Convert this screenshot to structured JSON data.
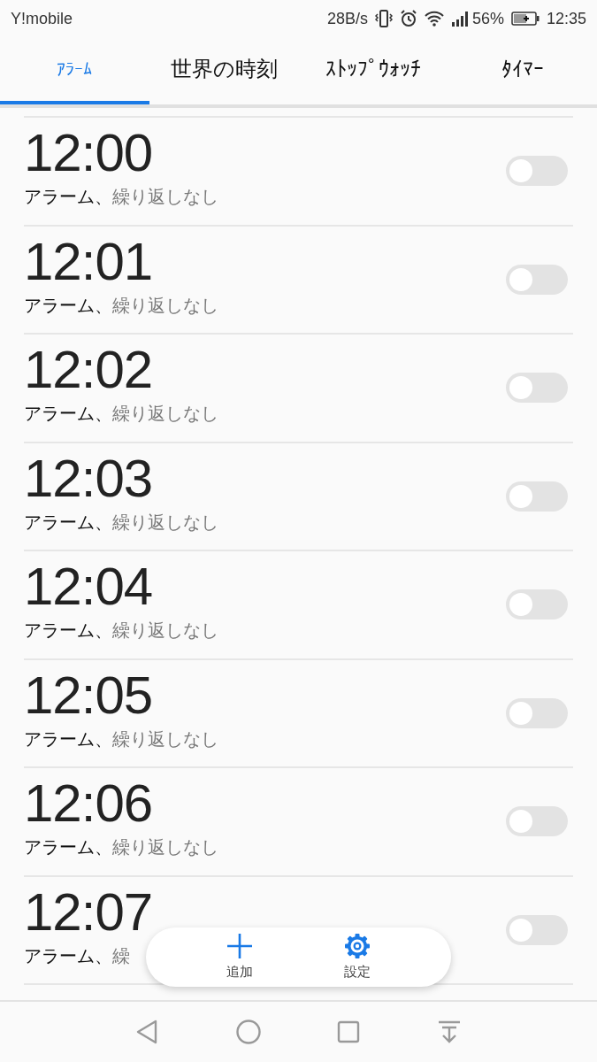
{
  "status_bar": {
    "carrier": "Y!mobile",
    "speed": "28B/s",
    "battery": "56%",
    "time": "12:35"
  },
  "tabs": [
    {
      "label": "ｱﾗｰﾑ",
      "selected": true
    },
    {
      "label": "世界の時刻",
      "selected": false
    },
    {
      "label": "ｽﾄｯﾌﾟｳｫｯﾁ",
      "selected": false
    },
    {
      "label": "ﾀｲﾏｰ",
      "selected": false
    }
  ],
  "alarms": [
    {
      "time": "12:00",
      "label": "アラーム、",
      "repeat": "繰り返しなし",
      "on": false
    },
    {
      "time": "12:01",
      "label": "アラーム、",
      "repeat": "繰り返しなし",
      "on": false
    },
    {
      "time": "12:02",
      "label": "アラーム、",
      "repeat": "繰り返しなし",
      "on": false
    },
    {
      "time": "12:03",
      "label": "アラーム、",
      "repeat": "繰り返しなし",
      "on": false
    },
    {
      "time": "12:04",
      "label": "アラーム、",
      "repeat": "繰り返しなし",
      "on": false
    },
    {
      "time": "12:05",
      "label": "アラーム、",
      "repeat": "繰り返しなし",
      "on": false
    },
    {
      "time": "12:06",
      "label": "アラーム、",
      "repeat": "繰り返しなし",
      "on": false
    },
    {
      "time": "12:07",
      "label": "アラーム、",
      "repeat": "繰",
      "on": false
    }
  ],
  "actions": [
    {
      "kind": "add",
      "label": "追加"
    },
    {
      "kind": "settings",
      "label": "設定"
    }
  ]
}
